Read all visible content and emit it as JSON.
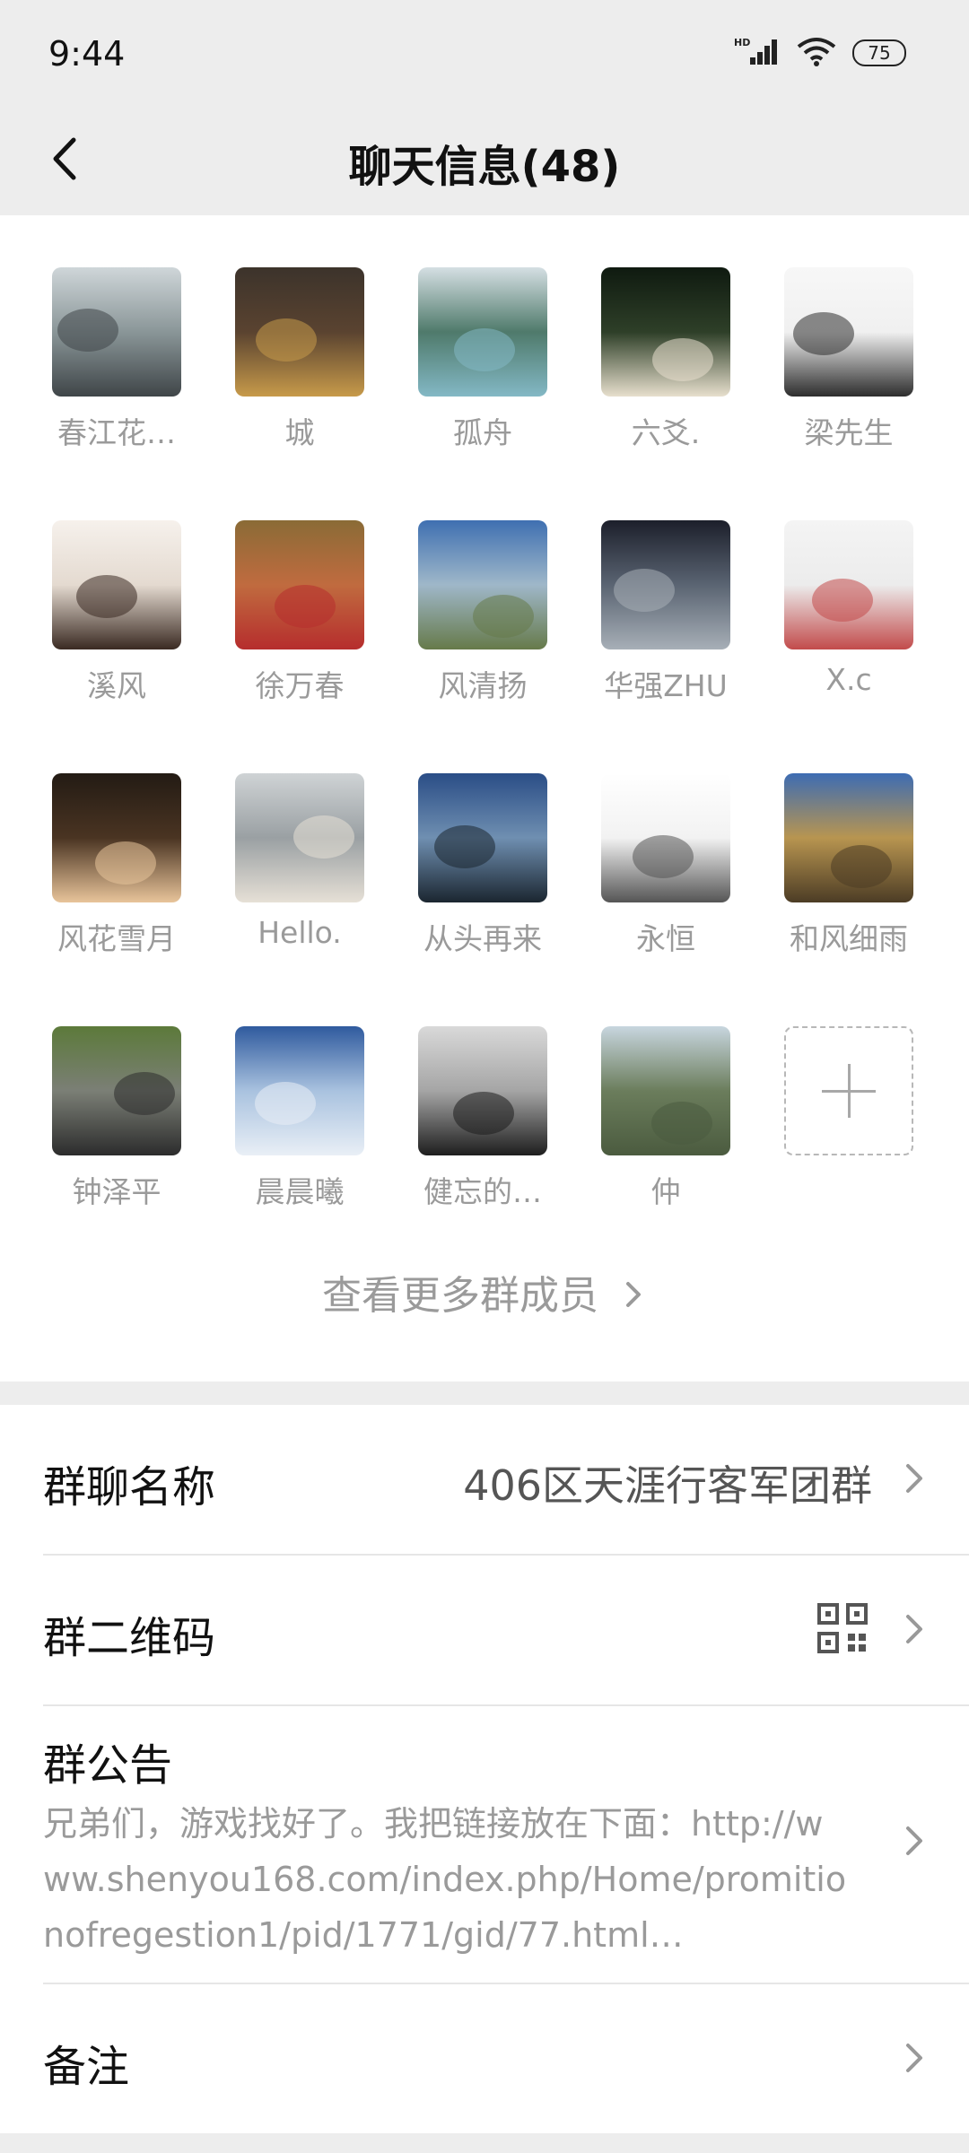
{
  "status": {
    "time": "9:44",
    "battery": "75"
  },
  "nav": {
    "title": "聊天信息(48)"
  },
  "members": [
    {
      "name": "春江花…",
      "colors": [
        "#cfd6d9",
        "#8a9698",
        "#3f4548"
      ]
    },
    {
      "name": "城",
      "colors": [
        "#3c332b",
        "#5a4330",
        "#c79a4a"
      ]
    },
    {
      "name": "孤舟",
      "colors": [
        "#d5dfe3",
        "#4f7a6b",
        "#83b8c5"
      ]
    },
    {
      "name": "六爻.",
      "colors": [
        "#0f1a10",
        "#2e3f28",
        "#e7dfcd"
      ]
    },
    {
      "name": "梁先生",
      "colors": [
        "#f7f7f7",
        "#f0f0f0",
        "#2d2d2d"
      ]
    },
    {
      "name": "溪风",
      "colors": [
        "#f6f1ec",
        "#e4dad0",
        "#3a2a22"
      ]
    },
    {
      "name": "徐万春",
      "colors": [
        "#8a6b36",
        "#c06b3f",
        "#b62d2d"
      ]
    },
    {
      "name": "风清扬",
      "colors": [
        "#3f6fb1",
        "#9fb7c9",
        "#667a4a"
      ]
    },
    {
      "name": "华强ZHU",
      "colors": [
        "#1c1f2a",
        "#5a6472",
        "#a7afb7"
      ]
    },
    {
      "name": "X.c",
      "colors": [
        "#f4f4f4",
        "#ececec",
        "#c24b4b"
      ]
    },
    {
      "name": "风花雪月",
      "colors": [
        "#231b14",
        "#4a3422",
        "#e8c49a"
      ]
    },
    {
      "name": "Hello.",
      "colors": [
        "#cfd3d5",
        "#9aa0a3",
        "#e6e0d6"
      ]
    },
    {
      "name": "从头再来",
      "colors": [
        "#2a4d86",
        "#6f8fb1",
        "#1b2630"
      ]
    },
    {
      "name": "永恒",
      "colors": [
        "#ffffff",
        "#f2f2f2",
        "#555555"
      ]
    },
    {
      "name": "和风细雨",
      "colors": [
        "#3d6cb3",
        "#b89550",
        "#4c3c25"
      ]
    },
    {
      "name": "钟泽平",
      "colors": [
        "#5c7a3a",
        "#7b7f76",
        "#2c2c2c"
      ]
    },
    {
      "name": "晨晨曦",
      "colors": [
        "#2f5a9e",
        "#a9c2df",
        "#e9eff6"
      ]
    },
    {
      "name": "健忘的…",
      "colors": [
        "#d9d9d9",
        "#a5a5a5",
        "#1e1e1e"
      ]
    },
    {
      "name": "仲",
      "colors": [
        "#c8d6df",
        "#6b7d5c",
        "#4b5b3f"
      ]
    }
  ],
  "view_more": "查看更多群成员",
  "settings": {
    "group_name_label": "群聊名称",
    "group_name_value": "406区天涯行客军团群",
    "qr_label": "群二维码",
    "notice_label": "群公告",
    "notice_text": "兄弟们，游戏找好了。我把链接放在下面：http://www.shenyou168.com/index.php/Home/promitionofregestion1/pid/1771/gid/77.html…",
    "remark_label": "备注"
  }
}
